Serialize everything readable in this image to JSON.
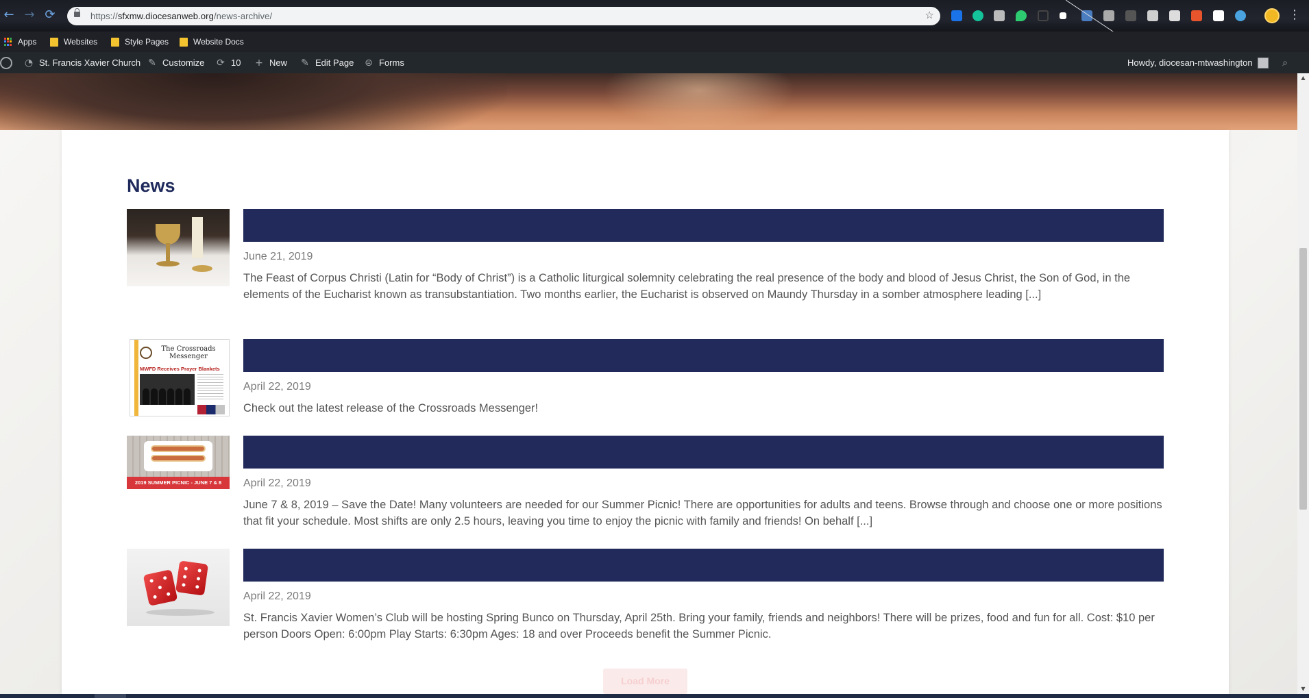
{
  "browser": {
    "url_prefix": "https://",
    "url_host": "sfxmw.diocesanweb.org",
    "url_path": "/news-archive/",
    "nav": {
      "back": "←",
      "forward": "→",
      "reload": "⟳"
    },
    "icons": [
      "back-icon",
      "forward-icon",
      "reload-icon",
      "lock-icon",
      "bookmark-star-icon",
      "profile-avatar",
      "menu-icon"
    ],
    "extensions_colors": [
      "#1a73e8",
      "#15c39a",
      "#bbbbbb",
      "#2ecc71",
      "#444444",
      "#ffffff",
      "#4a7cc0",
      "#aaaaaa",
      "#555555",
      "#cfcfcf",
      "#dddddd",
      "#e8542c",
      "#ffffff",
      "#4aa3df"
    ]
  },
  "bookmarks": {
    "items": [
      {
        "label": "Apps",
        "icon": "apps-grid-icon"
      },
      {
        "label": "Websites",
        "icon": "folder-icon"
      },
      {
        "label": "Style Pages",
        "icon": "folder-icon"
      },
      {
        "label": "Website Docs",
        "icon": "folder-icon"
      }
    ]
  },
  "adminbar": {
    "site_name": "St. Francis Xavier Church",
    "customize": "Customize",
    "updates_count": "10",
    "new": "New",
    "edit_page": "Edit Page",
    "forms": "Forms",
    "greeting": "Howdy, diocesan-mtwashington",
    "icons": [
      "wordpress-logo-icon",
      "dashboard-icon",
      "brush-icon",
      "refresh-icon",
      "plus-icon",
      "pencil-icon",
      "forms-icon",
      "avatar-icon",
      "search-icon"
    ]
  },
  "page": {
    "heading": "News",
    "load_more": "Load More",
    "title_bar_color": "#212a5b",
    "heading_color": "#1f2a5c"
  },
  "posts": [
    {
      "thumb": "chalice-photo",
      "date": "June 21, 2019",
      "excerpt": "The Feast of Corpus Christi (Latin for “Body of Christ”) is a Catholic liturgical solemnity celebrating the real presence of the body and blood of Jesus Christ, the Son of God, in the elements of the Eucharist known as transubstantiation. Two months earlier, the Eucharist is observed on Maundy Thursday in a somber atmosphere leading [...]"
    },
    {
      "thumb": "crossroads-messenger-cover",
      "thumb_masthead": "The Crossroads Messenger",
      "thumb_headline": "MWFD Receives Prayer Blankets",
      "date": "April 22, 2019",
      "excerpt": "Check out the latest release of the Crossroads Messenger!"
    },
    {
      "thumb": "summer-picnic-banner",
      "thumb_caption": "2019 SUMMER PICNIC - JUNE 7 & 8",
      "date": "April 22, 2019",
      "excerpt": "June 7 & 8, 2019 – Save the Date! Many volunteers are needed for our Summer Picnic! There are opportunities for adults and teens. Browse through and choose one or more positions that fit your schedule. Most shifts are only 2.5 hours, leaving you time to enjoy the picnic with family and friends! On behalf [...]"
    },
    {
      "thumb": "red-dice-photo",
      "date": "April 22, 2019",
      "excerpt": "St. Francis Xavier Women’s Club will be hosting Spring Bunco on Thursday, April 25th. Bring your family, friends and neighbors! There will be prizes, food and fun for all. Cost: $10 per person Doors Open: 6:00pm Play Starts: 6:30pm Ages: 18 and over  Proceeds benefit the Summer Picnic."
    }
  ]
}
